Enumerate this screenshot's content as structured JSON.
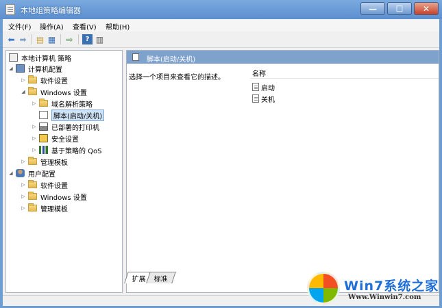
{
  "window": {
    "title": "本地组策略编辑器"
  },
  "menu": [
    "文件(F)",
    "操作(A)",
    "查看(V)",
    "帮助(H)"
  ],
  "toolbar": [
    "back-icon",
    "forward-icon",
    "up-folder-icon",
    "show-hide-tree-icon",
    "export-list-icon",
    "help-icon",
    "properties-icon"
  ],
  "tree": {
    "root": "本地计算机 策略",
    "computer_config": "计算机配置",
    "software_settings": "软件设置",
    "windows_settings": "Windows 设置",
    "dns_policy": "域名解析策略",
    "scripts": "脚本(启动/关机)",
    "printers": "已部署的打印机",
    "security": "安全设置",
    "qos": "基于策略的 QoS",
    "admin_templates": "管理模板",
    "user_config": "用户配置",
    "user_software": "软件设置",
    "user_windows": "Windows 设置",
    "user_admin": "管理模板"
  },
  "details": {
    "header": "脚本(启动/关机)",
    "description": "选择一个项目来查看它的描述。",
    "column_name": "名称",
    "items": [
      "启动",
      "关机"
    ]
  },
  "tabs": [
    "扩展",
    "标准"
  ],
  "watermark": {
    "brand": "Win7系统之家",
    "url": "Www.Winwin7.com"
  }
}
